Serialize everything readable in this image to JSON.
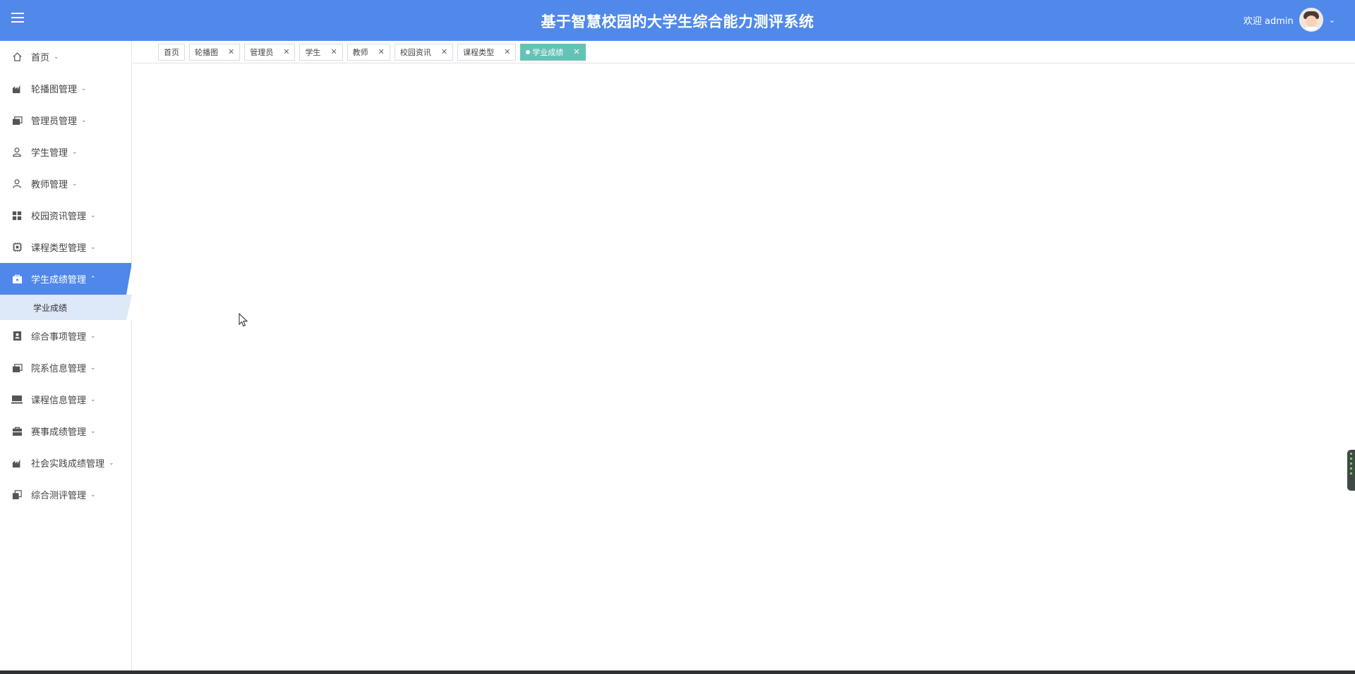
{
  "header": {
    "title": "基于智慧校园的大学生综合能力测评系统",
    "welcome_text": "欢迎 admin",
    "color": "#5189ea"
  },
  "sidebar": {
    "items": [
      {
        "label": "首页",
        "icon": "home-icon"
      },
      {
        "label": "轮播图管理",
        "icon": "chart-icon"
      },
      {
        "label": "管理员管理",
        "icon": "folders-icon"
      },
      {
        "label": "学生管理",
        "icon": "user-icon"
      },
      {
        "label": "教师管理",
        "icon": "user-outline-icon"
      },
      {
        "label": "校园资讯管理",
        "icon": "grid-icon"
      },
      {
        "label": "课程类型管理",
        "icon": "chip-icon"
      },
      {
        "label": "学生成绩管理",
        "icon": "briefcase-icon",
        "active": true
      },
      {
        "label": "综合事项管理",
        "icon": "contact-card-icon"
      },
      {
        "label": "院系信息管理",
        "icon": "folders-icon"
      },
      {
        "label": "课程信息管理",
        "icon": "laptop-icon"
      },
      {
        "label": "赛事成绩管理",
        "icon": "toolbox-icon"
      },
      {
        "label": "社会实践成绩管理",
        "icon": "chart-icon"
      },
      {
        "label": "综合测评管理",
        "icon": "copy-icon"
      }
    ],
    "sub_item": "学业成绩"
  },
  "tabs": [
    {
      "label": "首页",
      "closable": false
    },
    {
      "label": "轮播图",
      "closable": true
    },
    {
      "label": "管理员",
      "closable": true
    },
    {
      "label": "学生",
      "closable": true
    },
    {
      "label": "教师",
      "closable": true
    },
    {
      "label": "校园资讯",
      "closable": true
    },
    {
      "label": "课程类型",
      "closable": true
    },
    {
      "label": "学业成绩",
      "closable": true,
      "active": true
    }
  ],
  "close_glyph": "✕",
  "active_color": "#64c2b6"
}
